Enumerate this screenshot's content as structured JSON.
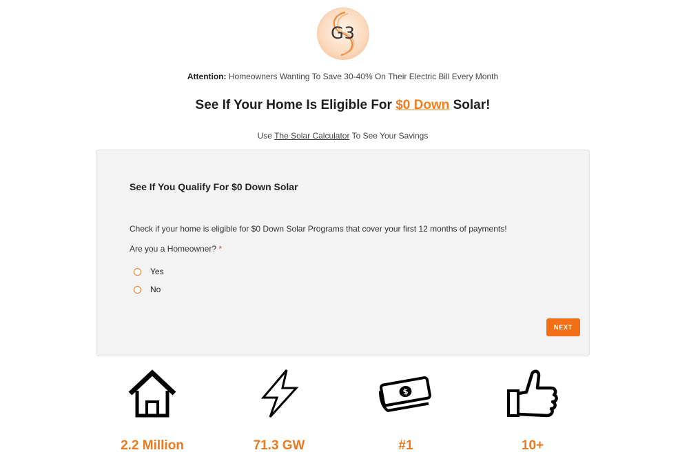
{
  "logo": {
    "text": "G3"
  },
  "attention": {
    "label": "Attention:",
    "text": " Homeowners Wanting To Save 30-40% On Their Electric Bill Every Month"
  },
  "headline": {
    "before": "See If Your Home Is Eligible For ",
    "accent": "$0 Down",
    "after": " Solar!"
  },
  "subline": {
    "before": "Use ",
    "link": "The Solar Calculator",
    "after": " To See Your Savings"
  },
  "form": {
    "title": "See If You Qualify For $0 Down Solar",
    "description": "Check if your home is eligible for $0 Down Solar Programs that cover your first 12 months of payments!",
    "question": "Are you a Homeowner?",
    "required_mark": "*",
    "options": [
      "Yes",
      "No"
    ],
    "next_label": "NEXT"
  },
  "stats": [
    {
      "icon": "house-icon",
      "value": "2.2 Million"
    },
    {
      "icon": "lightning-bolt-icon",
      "value": "71.3 GW"
    },
    {
      "icon": "money-icon",
      "value": "#1"
    },
    {
      "icon": "thumbs-up-icon",
      "value": "10+"
    }
  ],
  "colors": {
    "accent": "#f07d1f",
    "button": "#f36f16",
    "card_bg": "#f3f3f3",
    "required": "#e0442b"
  }
}
